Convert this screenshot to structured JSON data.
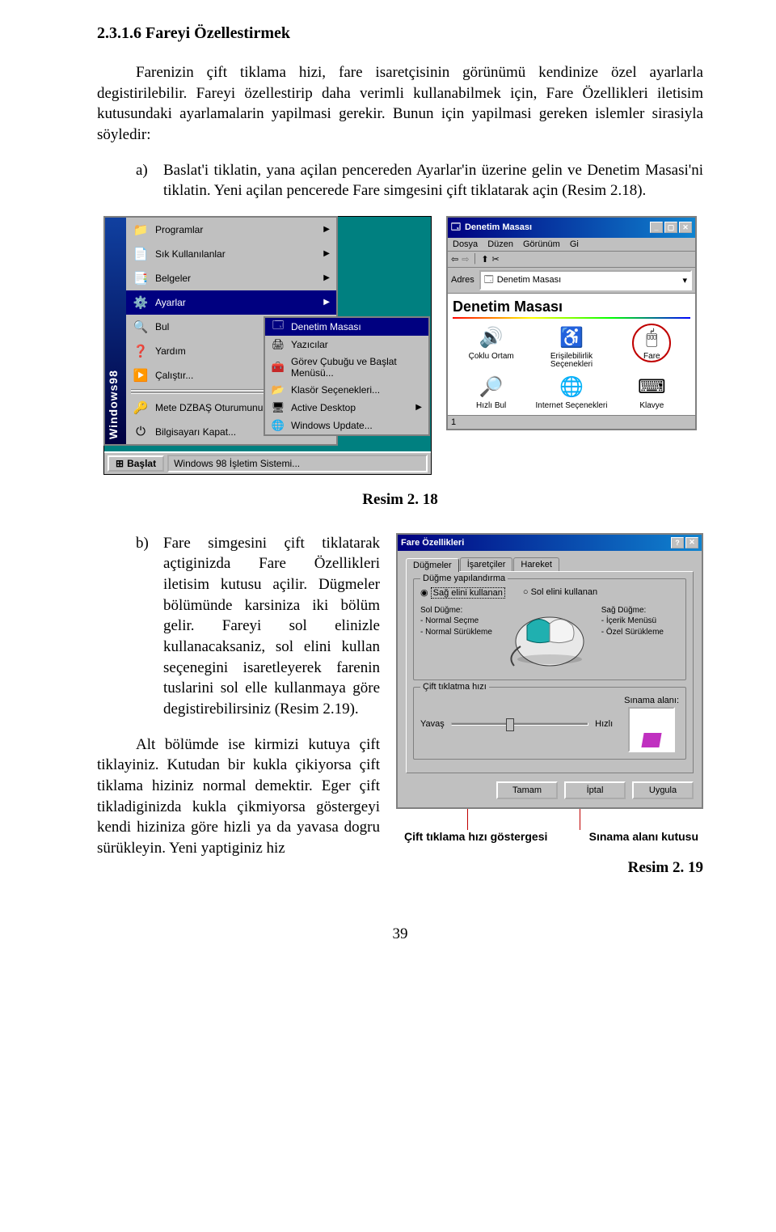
{
  "heading": "2.3.1.6 Fareyi Özellestirmek",
  "para_intro": "Farenizin çift tiklama hizi, fare isaretçisinin görünümü kendinize özel ayarlarla degistirilebilir. Fareyi özellestirip daha verimli kullanabilmek için, Fare Özellikleri iletisim kutusundaki ayarlamalarin yapilmasi gerekir. Bunun için yapilmasi gereken islemler sirasiyla söyledir:",
  "step_a_marker": "a)",
  "step_a_text": "Baslat'i tiklatin, yana açilan pencereden Ayarlar'in üzerine gelin ve Denetim Masasi'ni tiklatin. Yeni açilan pencerede Fare simgesini çift tiklatarak açin (Resim 2.18).",
  "fig218_caption": "Resim 2. 18",
  "startmenu": {
    "sidebar": "Windows98",
    "items": [
      {
        "icon": "📁",
        "label": "Programlar",
        "arrow": true
      },
      {
        "icon": "📄",
        "label": "Sık Kullanılanlar",
        "arrow": true
      },
      {
        "icon": "📑",
        "label": "Belgeler",
        "arrow": true
      },
      {
        "icon": "⚙️",
        "label": "Ayarlar",
        "arrow": true,
        "selected": true
      },
      {
        "icon": "🔍",
        "label": "Bul",
        "arrow": true
      },
      {
        "icon": "❓",
        "label": "Yardım"
      },
      {
        "icon": "▶️",
        "label": "Çalıştır..."
      },
      {
        "icon": "🔑",
        "label": "Mete DZBAŞ Oturumunu Kapat..."
      },
      {
        "icon": "⏻",
        "label": "Bilgisayarı Kapat..."
      }
    ],
    "submenu": [
      {
        "icon": "🗔",
        "label": "Denetim Masası",
        "selected": true
      },
      {
        "icon": "🖨",
        "label": "Yazıcılar"
      },
      {
        "icon": "🧰",
        "label": "Görev Çubuğu ve Başlat Menüsü..."
      },
      {
        "icon": "📂",
        "label": "Klasör Seçenekleri..."
      },
      {
        "icon": "🖥",
        "label": "Active Desktop",
        "arrow": true
      },
      {
        "icon": "🌐",
        "label": "Windows Update..."
      }
    ],
    "taskbar_start": "Başlat",
    "taskbar_task": "Windows 98 İşletim Sistemi..."
  },
  "cp": {
    "title": "Denetim Masası",
    "menus": [
      "Dosya",
      "Düzen",
      "Görünüm",
      "Gi"
    ],
    "addr_label": "Adres",
    "addr_value": "Denetim Masası",
    "header": "Denetim Masası",
    "status": "1",
    "items": [
      {
        "icon": "🔊",
        "label": "Çoklu Ortam"
      },
      {
        "icon": "♿",
        "label": "Erişilebilirlik Seçenekleri"
      },
      {
        "icon": "🖱",
        "label": "Fare",
        "fare": true
      },
      {
        "icon": "🔎",
        "label": "Hızlı Bul"
      },
      {
        "icon": "🌐",
        "label": "Internet Seçenekleri"
      },
      {
        "icon": "⌨",
        "label": "Klavye"
      }
    ]
  },
  "step_b_marker": "b)",
  "step_b_text": "Fare simgesini çift tiklatarak açtiginizda Fare Özellikleri iletisim kutusu açilir. Dügmeler bölümünde karsiniza iki bölüm gelir. Fareyi sol elinizle kullanacaksaniz, sol elini kullan seçenegini isaretleyerek farenin tuslarini sol elle kullanmaya göre degistirebilirsiniz (Resim 2.19).",
  "para_alt": "Alt bölümde ise kirmizi kutuya çift tiklayiniz. Kutudan bir kukla çikiyorsa çift tiklama hiziniz normal demektir. Eger çift tikladiginizda kukla çikmiyorsa göstergeyi kendi hiziniza göre hizli ya da yavasa dogru sürükleyin. Yeni yaptiginiz hiz",
  "mouse_dialog": {
    "title": "Fare Özellikleri",
    "tabs": [
      "Düğmeler",
      "İşaretçiler",
      "Hareket"
    ],
    "group_config_legend": "Düğme yapılandırma",
    "radio_right": "Sağ elini kullanan",
    "radio_left": "Sol elini kullanan",
    "left_btn_label": "Sol Düğme:",
    "left_btn_item1": "- Normal Seçme",
    "left_btn_item2": "- Normal Sürükleme",
    "right_btn_label": "Sağ Düğme:",
    "right_btn_item1": "- İçerik Menüsü",
    "right_btn_item2": "- Özel Sürükleme",
    "group_speed_legend": "Çift tıklatma hızı",
    "slow": "Yavaş",
    "fast": "Hızlı",
    "test_label": "Sınama alanı:",
    "btn_ok": "Tamam",
    "btn_cancel": "İptal",
    "btn_apply": "Uygula"
  },
  "callout_left": "Çift tıklama hızı göstergesi",
  "callout_right": "Sınama alanı kutusu",
  "fig219_caption": "Resim 2. 19",
  "page_number": "39"
}
